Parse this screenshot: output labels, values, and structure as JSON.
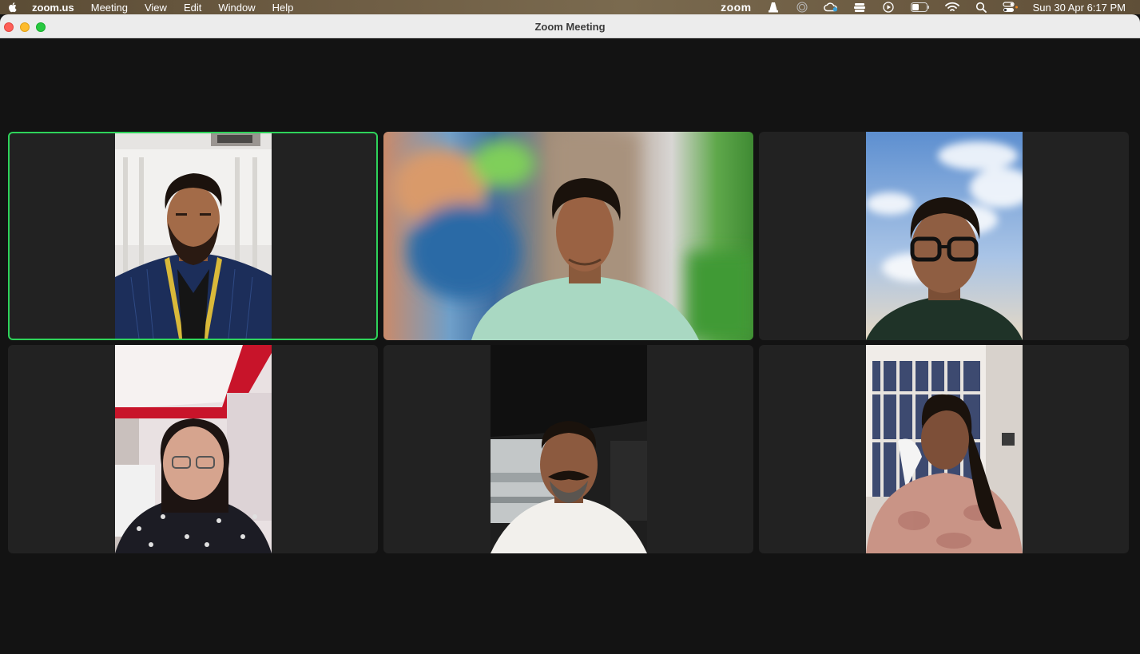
{
  "menubar": {
    "app_name": "zoom.us",
    "menus": [
      "Meeting",
      "View",
      "Edit",
      "Window",
      "Help"
    ],
    "status_zoom": "zoom",
    "clock": "Sun 30 Apr  6:17 PM",
    "status_icons": [
      "zoom-status-icon",
      "vlc-icon",
      "activity-icon",
      "creative-cloud-icon",
      "stage-manager-icon",
      "play-icon",
      "battery-icon",
      "wifi-icon",
      "spotlight-icon",
      "control-center-icon"
    ]
  },
  "window": {
    "title": "Zoom Meeting"
  },
  "gallery": {
    "active_speaker_color": "#2ed35a",
    "participants": [
      {
        "id": "p1",
        "speaking": true
      },
      {
        "id": "p2",
        "speaking": false
      },
      {
        "id": "p3",
        "speaking": false
      },
      {
        "id": "p4",
        "speaking": false
      },
      {
        "id": "p5",
        "speaking": false
      },
      {
        "id": "p6",
        "speaking": false
      }
    ]
  }
}
